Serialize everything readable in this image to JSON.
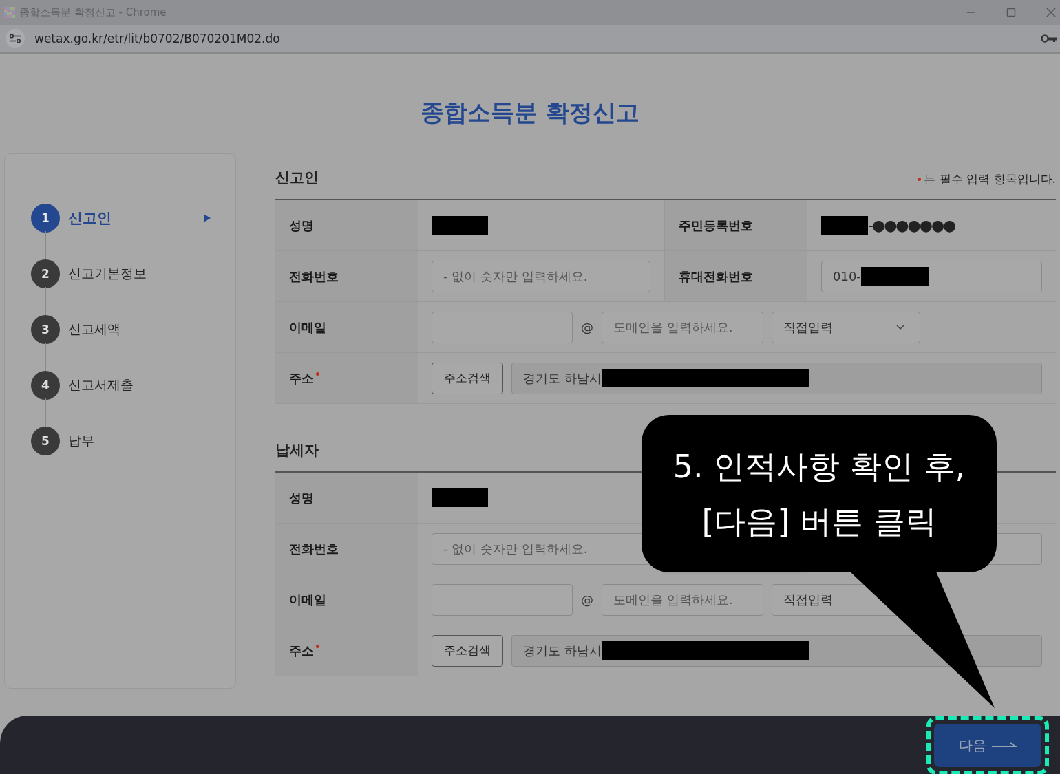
{
  "browser": {
    "title": "종합소득분 확정신고 - Chrome",
    "url": "wetax.go.kr/etr/lit/b0702/B070201M02.do"
  },
  "page_title": "종합소득분 확정신고",
  "steps": [
    {
      "number": "1",
      "label": "신고인",
      "selected": true
    },
    {
      "number": "2",
      "label": "신고기본정보",
      "selected": false
    },
    {
      "number": "3",
      "label": "신고세액",
      "selected": false
    },
    {
      "number": "4",
      "label": "신고서제출",
      "selected": false
    },
    {
      "number": "5",
      "label": "납부",
      "selected": false
    }
  ],
  "required_note": "는 필수 입력 항목입니다.",
  "sections": [
    {
      "title": "신고인",
      "rows": [
        {
          "kind": "name",
          "label": "성명",
          "redacted": true,
          "right_label": "주민등록번호",
          "right_redacted": true,
          "masked": "-●●●●●●●"
        },
        {
          "kind": "phone",
          "label": "전화번호",
          "placeholder": "- 없이 숫자만 입력하세요.",
          "right_label": "휴대전화번호",
          "mobile_value": "010-",
          "mobile_redacted": true
        },
        {
          "kind": "email",
          "label": "이메일",
          "at": "@",
          "domain_placeholder": "도메인을 입력하세요.",
          "select": "직접입력",
          "dropdown_arrow": true
        },
        {
          "kind": "address",
          "label": "주소",
          "required": true,
          "button": "주소검색",
          "value": "경기도 하남시",
          "redacted": true
        }
      ]
    },
    {
      "title": "납세자",
      "rows": [
        {
          "kind": "name",
          "label": "성명",
          "redacted": true
        },
        {
          "kind": "phone",
          "label": "전화번호",
          "placeholder": "- 없이 숫자만 입력하세요."
        },
        {
          "kind": "email",
          "label": "이메일",
          "at": "@",
          "domain_placeholder": "도메인을 입력하세요.",
          "select": "직접입력"
        },
        {
          "kind": "address",
          "label": "주소",
          "required": true,
          "button": "주소검색",
          "value": "경기도 하남시",
          "redacted": true
        }
      ]
    }
  ],
  "callout": {
    "lines": [
      "5. 인적사항 확인 후,",
      "[다음] 버튼 클릭"
    ]
  },
  "next_button": {
    "label": "다음",
    "highlighted": true
  }
}
